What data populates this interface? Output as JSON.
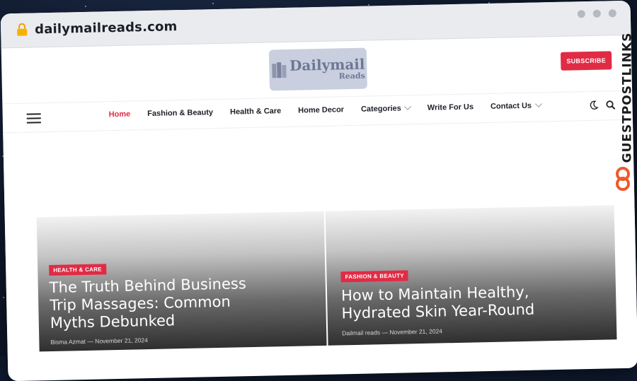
{
  "browser": {
    "url": "dailymailreads.com"
  },
  "header": {
    "logo_main": "Dailymail",
    "logo_sub": "Reads",
    "subscribe_label": "SUBSCRIBE"
  },
  "nav": {
    "items": [
      {
        "label": "Home",
        "active": true
      },
      {
        "label": "Fashion & Beauty"
      },
      {
        "label": "Health & Care"
      },
      {
        "label": "Home Decor"
      },
      {
        "label": "Categories",
        "has_dropdown": true
      },
      {
        "label": "Write For Us"
      },
      {
        "label": "Contact Us",
        "has_dropdown": true
      }
    ]
  },
  "posts": [
    {
      "category": "HEALTH & CARE",
      "title": "The Truth Behind Business Trip Massages: Common Myths Debunked",
      "author": "Bisma Azmat",
      "separator": "—",
      "date": "November 21, 2024"
    },
    {
      "category": "FASHION & BEAUTY",
      "title": "How to Maintain Healthy, Hydrated Skin Year-Round",
      "author": "Dailmail reads",
      "separator": "—",
      "date": "November 21, 2024"
    }
  ],
  "watermark": {
    "text": "GUESTPOSTLINKS"
  },
  "colors": {
    "accent": "#e12b45",
    "logo_bg": "#c9cfdf"
  }
}
